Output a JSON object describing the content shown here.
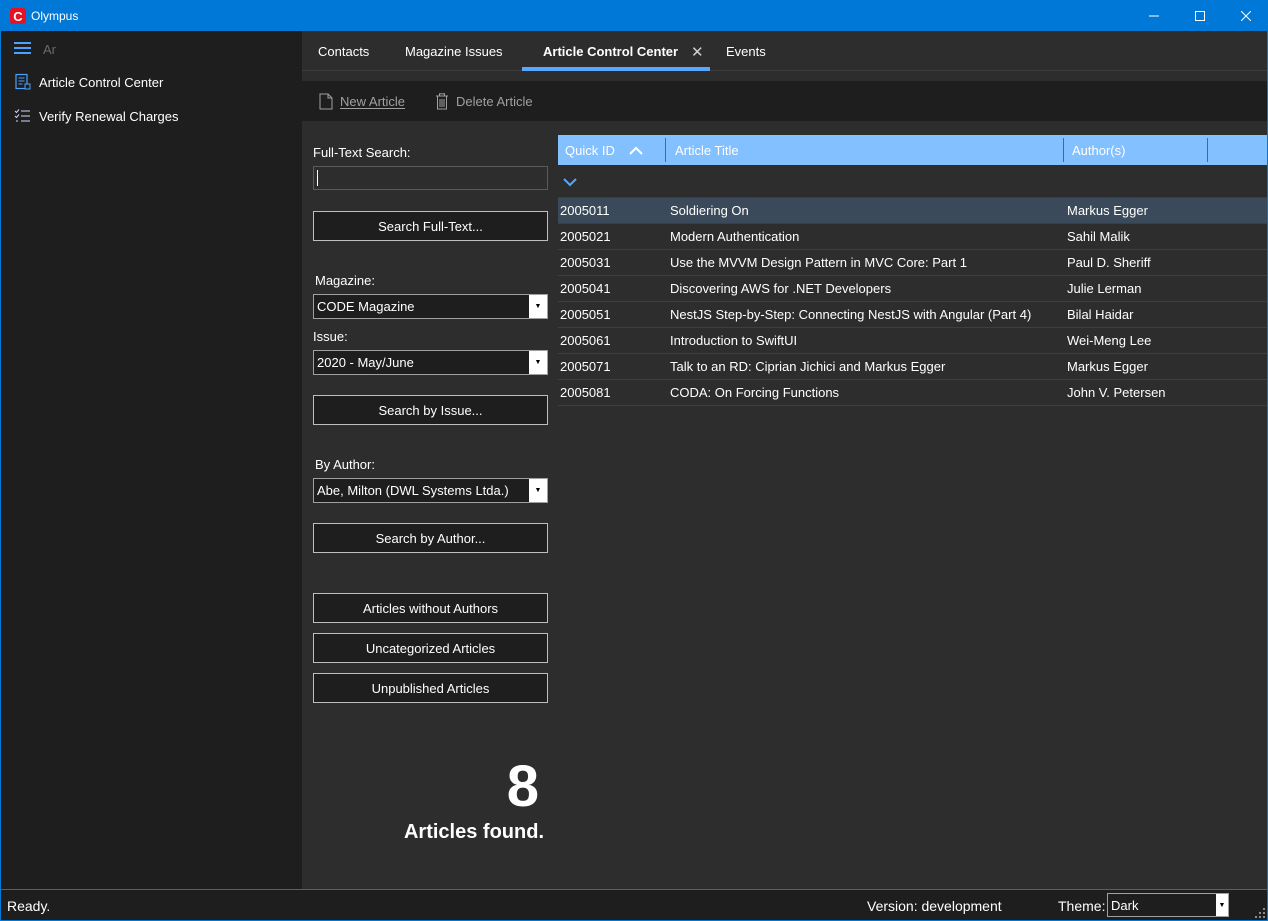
{
  "window": {
    "title": "Olympus",
    "logo_letter": "C",
    "controls": {
      "minimize": "—",
      "maximize": "☐",
      "close": "✕"
    }
  },
  "sidebar": {
    "search_value": "Ar",
    "items": [
      {
        "label": "Article Control Center",
        "icon": "article-icon"
      },
      {
        "label": "Verify Renewal Charges",
        "icon": "checklist-icon"
      }
    ]
  },
  "tabs": [
    {
      "label": "Contacts",
      "active": false
    },
    {
      "label": "Magazine Issues",
      "active": false
    },
    {
      "label": "Article Control Center",
      "active": true,
      "closable": true
    },
    {
      "label": "Events",
      "active": false
    }
  ],
  "toolbar": {
    "new_article": "New Article",
    "delete_article": "Delete Article"
  },
  "search_panel": {
    "fulltext_label": "Full-Text Search:",
    "fulltext_value": "",
    "search_fulltext_button": "Search Full-Text...",
    "magazine_label": "Magazine:",
    "magazine_value": "CODE Magazine",
    "issue_label": "Issue:",
    "issue_value": "2020 - May/June",
    "search_issue_button": "Search by Issue...",
    "author_label": "By Author:",
    "author_value": "Abe, Milton (DWL Systems Ltda.)",
    "search_author_button": "Search by Author...",
    "without_authors_button": "Articles without Authors",
    "uncategorized_button": "Uncategorized Articles",
    "unpublished_button": "Unpublished Articles",
    "count": "8",
    "count_label": "Articles found."
  },
  "grid": {
    "columns": [
      "Quick ID",
      "Article Title",
      "Author(s)"
    ],
    "sort_column": "Quick ID",
    "sort_direction": "ascending",
    "selected_row": 0,
    "rows": [
      [
        "2005011",
        "Soldiering On",
        "Markus Egger"
      ],
      [
        "2005021",
        "Modern Authentication",
        "Sahil Malik"
      ],
      [
        "2005031",
        "Use the MVVM Design Pattern in MVC Core: Part 1",
        "Paul D. Sheriff"
      ],
      [
        "2005041",
        "Discovering AWS for .NET Developers",
        "Julie Lerman"
      ],
      [
        "2005051",
        "NestJS Step-by-Step: Connecting NestJS with Angular (Part 4)",
        "Bilal Haidar"
      ],
      [
        "2005061",
        "Introduction to SwiftUI",
        "Wei-Meng Lee"
      ],
      [
        "2005071",
        "Talk to an RD: Ciprian Jichici and Markus Egger",
        "Markus Egger"
      ],
      [
        "2005081",
        "CODA: On Forcing Functions",
        "John V. Petersen"
      ]
    ]
  },
  "statusbar": {
    "status": "Ready.",
    "version": "Version: development",
    "theme_label": "Theme:",
    "theme_value": "Dark"
  },
  "colors": {
    "accent": "#0078d7",
    "header_blue": "#83c0ff",
    "tab_underline": "#55a7ff",
    "sidebar_bg": "#1e1e1e",
    "content_bg": "#2d2d2d",
    "logo_red": "#e81123"
  }
}
